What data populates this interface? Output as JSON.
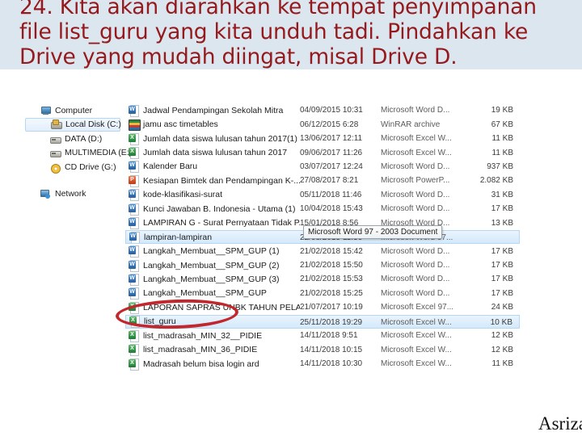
{
  "slide": {
    "caption": "24. Kita akan diarahkan ke tempat penyimpanan file list_guru yang kita unduh tadi. Pindahkan ke Drive yang mudah diingat, misal Drive D.",
    "caption_color": "#951a1d",
    "band_color": "#dce6ef",
    "signature": "Asriza"
  },
  "explorer": {
    "nav_pane": {
      "items": [
        {
          "label": "Computer",
          "icon": "computer-icon",
          "level": 1,
          "selected": false
        },
        {
          "label": "Local Disk (C:)",
          "icon": "harddisk-icon",
          "level": 2,
          "selected": true
        },
        {
          "label": "DATA (D:)",
          "icon": "drive-icon",
          "level": 2,
          "selected": false
        },
        {
          "label": "MULTIMEDIA (E:)",
          "icon": "drive-icon",
          "level": 2,
          "selected": false
        },
        {
          "label": "CD Drive (G:)",
          "icon": "cd-icon",
          "level": 2,
          "selected": false
        },
        {
          "label": "Network",
          "icon": "network-icon",
          "level": 1,
          "selected": false
        }
      ]
    },
    "tooltip": "Microsoft Word 97 - 2003 Document",
    "annotation": {
      "shape": "ellipse",
      "color": "#c1272d",
      "targets": "list_guru"
    },
    "files": [
      {
        "name": "Jadwal Pendampingan Sekolah Mitra",
        "date": "04/09/2015 10:31",
        "type": "Microsoft Word D...",
        "size": "19 KB",
        "icon": "word-icon",
        "selected": false
      },
      {
        "name": "jamu asc timetables",
        "date": "06/12/2015 6:28",
        "type": "WinRAR archive",
        "size": "67 KB",
        "icon": "rar-icon",
        "selected": false
      },
      {
        "name": "Jumlah data siswa lulusan tahun 2017(1)",
        "date": "13/06/2017 12:11",
        "type": "Microsoft Excel W...",
        "size": "11 KB",
        "icon": "excel-icon",
        "selected": false
      },
      {
        "name": "Jumlah data siswa lulusan tahun 2017",
        "date": "09/06/2017 11:26",
        "type": "Microsoft Excel W...",
        "size": "11 KB",
        "icon": "excel-icon",
        "selected": false
      },
      {
        "name": "Kalender Baru",
        "date": "03/07/2017 12:24",
        "type": "Microsoft Word D...",
        "size": "937 KB",
        "icon": "word-icon",
        "selected": false
      },
      {
        "name": "Kesiapan Bimtek dan Pendampingan  K-...",
        "date": "27/08/2017 8:21",
        "type": "Microsoft PowerP...",
        "size": "2.082 KB",
        "icon": "ppt-icon",
        "selected": false
      },
      {
        "name": "kode-klasifikasi-surat",
        "date": "05/11/2018 11:46",
        "type": "Microsoft Word D...",
        "size": "31 KB",
        "icon": "word-icon",
        "selected": false
      },
      {
        "name": "Kunci Jawaban B. Indonesia - Utama (1)",
        "date": "10/04/2018 15:43",
        "type": "Microsoft Word D...",
        "size": "17 KB",
        "icon": "word-icon",
        "selected": false
      },
      {
        "name": "LAMPIRAN G - Surat Pernyataan Tidak P...",
        "date": "15/01/2018 8:56",
        "type": "Microsoft Word D...",
        "size": "13 KB",
        "icon": "word-icon",
        "selected": false
      },
      {
        "name": "lampiran-lampiran",
        "date": "22/08/2015 11:36",
        "type": "Microsoft Word 97...",
        "size": "",
        "icon": "word-icon",
        "selected": true
      },
      {
        "name": "Langkah_Membuat__SPM_GUP (1)",
        "date": "21/02/2018 15:42",
        "type": "Microsoft Word D...",
        "size": "17 KB",
        "icon": "word-icon",
        "selected": false
      },
      {
        "name": "Langkah_Membuat__SPM_GUP (2)",
        "date": "21/02/2018 15:50",
        "type": "Microsoft Word D...",
        "size": "17 KB",
        "icon": "word-icon",
        "selected": false
      },
      {
        "name": "Langkah_Membuat__SPM_GUP (3)",
        "date": "21/02/2018 15:53",
        "type": "Microsoft Word D...",
        "size": "17 KB",
        "icon": "word-icon",
        "selected": false
      },
      {
        "name": "Langkah_Membuat__SPM_GUP",
        "date": "21/02/2018 15:25",
        "type": "Microsoft Word D...",
        "size": "17 KB",
        "icon": "word-icon",
        "selected": false
      },
      {
        "name": "LAPORAN SAPRAS UNBK TAHUN PELAJ...",
        "date": "21/07/2017 10:19",
        "type": "Microsoft Excel 97...",
        "size": "24 KB",
        "icon": "excel-icon",
        "selected": false
      },
      {
        "name": "list_guru",
        "date": "25/11/2018 19:29",
        "type": "Microsoft Excel W...",
        "size": "10 KB",
        "icon": "excel-icon",
        "selected": true
      },
      {
        "name": "list_madrasah_MIN_32__PIDIE",
        "date": "14/11/2018 9:51",
        "type": "Microsoft Excel W...",
        "size": "12 KB",
        "icon": "excel-icon",
        "selected": false
      },
      {
        "name": "list_madrasah_MIN_36_PIDIE",
        "date": "14/11/2018 10:15",
        "type": "Microsoft Excel W...",
        "size": "12 KB",
        "icon": "excel-icon",
        "selected": false
      },
      {
        "name": "Madrasah belum bisa login ard",
        "date": "14/11/2018 10:30",
        "type": "Microsoft Excel W...",
        "size": "11 KB",
        "icon": "excel-icon",
        "selected": false
      }
    ]
  }
}
